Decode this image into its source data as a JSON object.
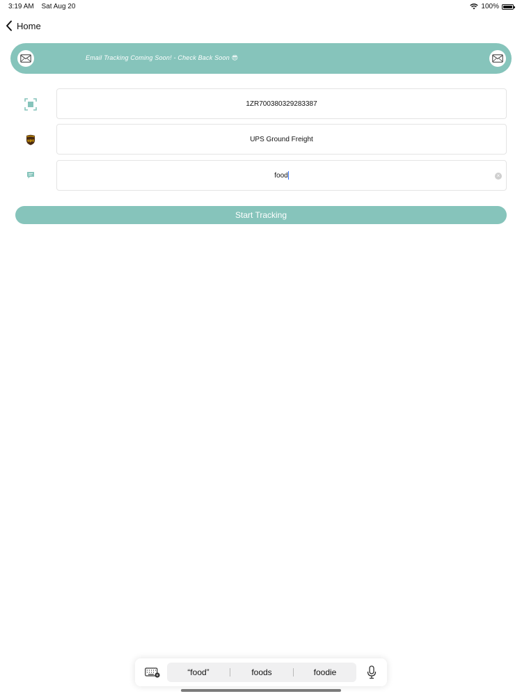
{
  "status_bar": {
    "time": "3:19 AM",
    "date": "Sat Aug 20",
    "battery": "100%"
  },
  "nav": {
    "back_label": "Home"
  },
  "banner": {
    "text": "Email Tracking Coming Soon! - Check Back Soon 😎",
    "left_icon": "mail-icon",
    "right_icon": "mail-icon"
  },
  "fields": {
    "tracking_number": {
      "value": "1ZR700380329283387",
      "icon": "scan-icon"
    },
    "carrier": {
      "value": "UPS Ground Freight",
      "icon": "ups-logo-icon"
    },
    "description": {
      "value": "food",
      "icon": "message-icon"
    }
  },
  "start_button": {
    "label": "Start Tracking"
  },
  "keyboard": {
    "suggestions": [
      "“food”",
      "foods",
      "foodie"
    ]
  },
  "colors": {
    "accent": "#86c4bb"
  }
}
